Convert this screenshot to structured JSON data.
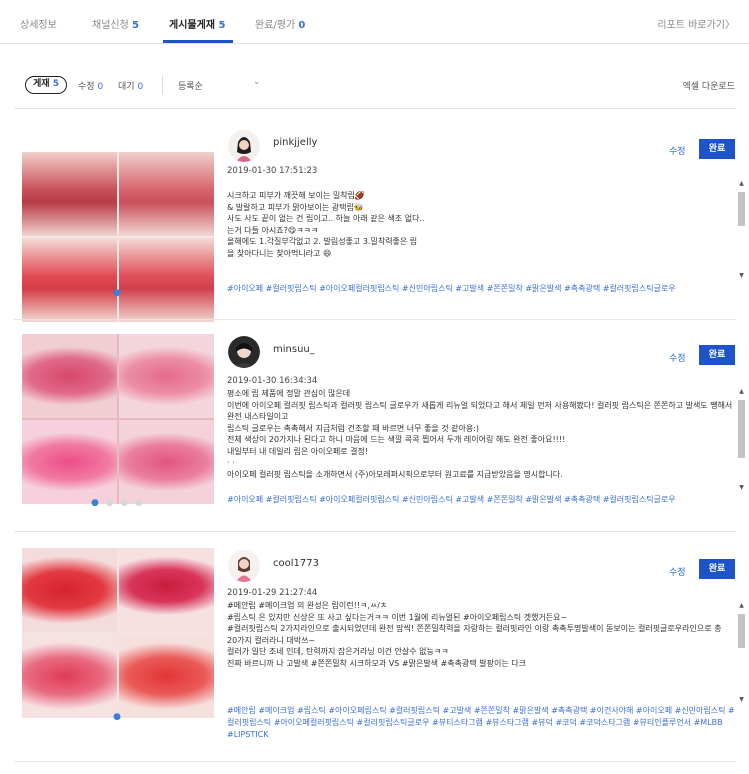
{
  "tabs": [
    {
      "label": "상세정보",
      "count": ""
    },
    {
      "label": "채널신청",
      "count": "5"
    },
    {
      "label": "게시물게재",
      "count": "5"
    },
    {
      "label": "완료/평가",
      "count": "0"
    }
  ],
  "report_link": "리포트 바로가기〉",
  "filters": {
    "active": {
      "label": "게재",
      "count": "5"
    },
    "edit": {
      "label": "수정",
      "count": "0"
    },
    "wait": {
      "label": "대기",
      "count": "0"
    },
    "sort": "등록순",
    "sort_chevron": "⌄",
    "excel": "엑셀 다운로드"
  },
  "buttons": {
    "edit": "수정",
    "done": "완료"
  },
  "scroll": {
    "up": "▲",
    "down": "▼"
  },
  "posts": [
    {
      "username": "pinkjjelly",
      "date": "2019-01-30 17:51:23",
      "lines": [
        "시크하고 피부가 깨끗해 보이는 밀착립🏈",
        "& 발랄하고 피부가 맑아보이는 광택립🐝",
        "사도 사도 끝이 없는 건 립이고.. 하늘 아래 같은 색조 없다..",
        "는거 다들 아시죠?😋ㅋㅋㅋ",
        "",
        "올해에도 1.각질부각없고 2. 발림성좋고 3.밀착력좋은 립",
        "을 찾아다니는 찾아먹니라고 😄"
      ],
      "hashtags": "#아이오페 #컬러핏립스틱 #아이오페컬러핏립스틱 #신민아립스틱 #고발색 #쫀쫀밀착 #맑은발색 #촉촉광택 #컬러핏립스틱글로우",
      "dots": {
        "on": "●",
        "off": ""
      }
    },
    {
      "username": "minsuu_",
      "date": "2019-01-30 16:34:34",
      "lines": [
        "평소에 립 제품에 정말 관심이 많은데",
        "이번에 아이오페 컬러핏 립스틱과 컬러핏 립스틱 글로우가 새롭게 리뉴얼 되었다고 해서 제일 먼저 사용해봤다! 컬러핏 립스틱은 쫀쫀하고 발색도 쨍해서 완전 내스타일이고",
        "립스틱 글로우는 촉촉해서 지금처럼 건조할 때 바르면 너무 좋을 것 같아용:)",
        "전체 색상이 20가지나 된다고 하니 마음에 드는 색깔 콕콕 찝어서 두개 레이어링 해도 완전 좋아요!!!!",
        "내일부터 내 데일리 립은 아이오페로 결정!",
        "· ·",
        "아이오페 컬러핏 립스틱을 소개하면서 (주)아모레퍼시픽으로부터 원고료를 지급받았음을 명시합니다."
      ],
      "hashtags": "#아이오페 #컬러핏립스틱 #아이오페컬러핏립스틱 #신민아립스틱 #고발색 #쫀쫀밀착 #맑은발색 #촉촉광택 #컬러핏립스틱글로우",
      "dots": {
        "on": "●",
        "off": "● ● ●"
      }
    },
    {
      "username": "cool1773",
      "date": "2019-01-29 21:27:44",
      "lines": [
        "#메안립 #메이크업 의 완성은 립이런!!ㅋ,ㅆ/ㅊ",
        "#립스틱 은 있지만 신상은 또 사고 싶다는거ㅋㅋ 이번 1월에 리뉴얼된 #아이오페립스틱 겟했거든요~",
        "",
        "#컬러핏립스틱 2가지라인으로 출시되었던데 완전 맘씩! 쫀쫀밀착력을 자랑하는 컬러핏라인 이랑 촉촉투명발색이 돋보이는 컬러핏글로우라인으로 총 20가지 컬러라니 대박쓰~",
        "컬러가 일단 조네 인데, 탄력까지 잡은거라닝 이건 안살수 없능ㅋㅋ",
        "",
        "진짜 바르니까 나 고발색 #쫀쫀밀착 시크하모과 VS #맑은발색 #촉촉광택 발팡이는 다크"
      ],
      "hashtags": "#메안립 #메이크업 #립스틱 #아이오페립스틱 #컬러핏립스틱 #고발색 #쫀쫀밀착 #맑은발색 #촉촉광택 #이건사야해 #아이오페 #신민아립스틱 #컬러핏립스틱 #아이오페컬러핏립스틱 #컬러핏립스틱글로우 #뷰티스타그램 #뷰스타그램 #뷰덕 #코덕 #코덕스타그램 #뷰티인플루언서 #MLBB #LIPSTICK",
      "dots": {
        "on": "●",
        "off": ""
      }
    }
  ],
  "colors": {
    "accent": "#1d55c9",
    "count": "#3b6fd8",
    "hashtag": "#3b6fd8"
  }
}
